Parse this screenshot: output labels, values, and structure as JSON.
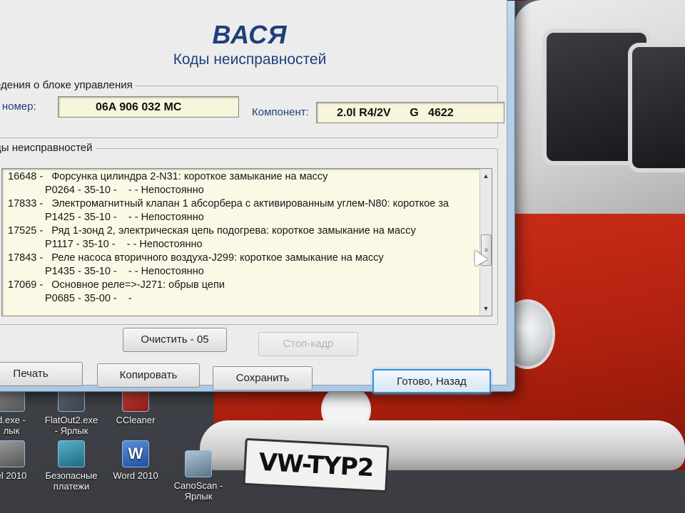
{
  "window": {
    "close_symbol": "✕",
    "app_title": "ВАСЯ",
    "app_subtitle": "Коды неисправностей"
  },
  "ecu_info": {
    "legend": "едения о блоке управления",
    "part_number_label": "G номер:",
    "part_number_value": "06A 906 032 MC",
    "component_label": "Компонент:",
    "component_value": "2.0l R4/2V      G   4622"
  },
  "faults": {
    "legend": "ды неисправностей",
    "lines": [
      {
        "kind": "main",
        "text": "16648 -   Форсунка цилиндра 2-N31: короткое замыкание на массу"
      },
      {
        "kind": "sub",
        "text": "P0264 - 35-10 -    - - Непостоянно"
      },
      {
        "kind": "main",
        "text": "17833 -   Электромагнитный клапан 1 абсорбера с активированным углем-N80: короткое за"
      },
      {
        "kind": "sub",
        "text": "P1425 - 35-10 -    - - Непостоянно"
      },
      {
        "kind": "main",
        "text": "17525 -   Ряд 1-зонд 2, электрическая цепь подогрева: короткое замыкание на массу"
      },
      {
        "kind": "sub",
        "text": "P1117 - 35-10 -    - - Непостоянно"
      },
      {
        "kind": "main",
        "text": "17843 -   Реле насоса вторичного воздуха-J299: короткое замыкание на массу"
      },
      {
        "kind": "sub",
        "text": "P1435 - 35-10 -    - - Непостоянно"
      },
      {
        "kind": "main",
        "text": "17069 -   Основное реле=>-J271: обрыв цепи"
      },
      {
        "kind": "sub",
        "text": "P0685 - 35-00 -    -"
      }
    ],
    "scroll_up_symbol": "▲",
    "scroll_down_symbol": "▼",
    "scroll_thumb_grip": "≡"
  },
  "buttons": {
    "clear": "Очистить - 05",
    "freeze_frame": "Стоп-кадр",
    "print": "Печать",
    "copy": "Копировать",
    "save": "Сохранить",
    "done_back": "Готово, Назад"
  },
  "desktop": {
    "icons": [
      {
        "label": "d.exe -\nлык",
        "glyph": "generic"
      },
      {
        "label": "FlatOut2.exe\n- Ярлык",
        "glyph": "ff"
      },
      {
        "label": "CCleaner",
        "glyph": "cc"
      },
      {
        "label": "el 2010",
        "glyph": "generic"
      },
      {
        "label": "Безопасные\nплатежи",
        "glyph": "safe"
      },
      {
        "label": "Word 2010",
        "glyph": "w"
      },
      {
        "label": "CanoScan -\nЯрлык",
        "glyph": "scan"
      }
    ],
    "plate_text": "VW-TYP2"
  }
}
